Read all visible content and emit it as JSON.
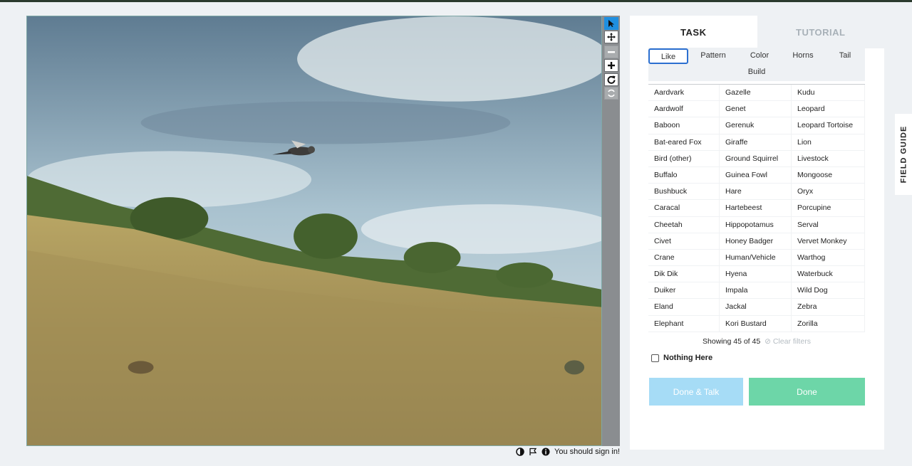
{
  "colors": {
    "accent_blue": "#2b6fd0",
    "talk_button": "#a6dcf6",
    "done_button": "#6dd6a8",
    "toolbar": "#8a8d90"
  },
  "toolbar": {
    "tools": [
      {
        "name": "pointer-tool",
        "icon": "cursor-arrow-icon",
        "state": "active"
      },
      {
        "name": "pan-tool",
        "icon": "move-arrows-icon",
        "state": "normal"
      },
      {
        "name": "zoom-out-tool",
        "icon": "minus-icon",
        "state": "disabled"
      },
      {
        "name": "zoom-in-tool",
        "icon": "plus-icon",
        "state": "normal"
      },
      {
        "name": "rotate-tool",
        "icon": "rotate-icon",
        "state": "normal"
      },
      {
        "name": "reset-tool",
        "icon": "refresh-icon",
        "state": "disabled"
      }
    ]
  },
  "footer": {
    "sign_in_text": "You should sign in!",
    "icons": [
      "contrast-icon",
      "flag-icon",
      "info-icon"
    ]
  },
  "tabs": {
    "task": "TASK",
    "tutorial": "TUTORIAL"
  },
  "filters": {
    "row1": [
      "Like",
      "Pattern",
      "Color",
      "Horns",
      "Tail"
    ],
    "row2": [
      "Build"
    ],
    "selected": "Like"
  },
  "species": {
    "col1": [
      "Aardvark",
      "Aardwolf",
      "Baboon",
      "Bat-eared Fox",
      "Bird (other)",
      "Buffalo",
      "Bushbuck",
      "Caracal",
      "Cheetah",
      "Civet",
      "Crane",
      "Dik Dik",
      "Duiker",
      "Eland",
      "Elephant"
    ],
    "col2": [
      "Gazelle",
      "Genet",
      "Gerenuk",
      "Giraffe",
      "Ground Squirrel",
      "Guinea Fowl",
      "Hare",
      "Hartebeest",
      "Hippopotamus",
      "Honey Badger",
      "Human/Vehicle",
      "Hyena",
      "Impala",
      "Jackal",
      "Kori Bustard"
    ],
    "col3": [
      "Kudu",
      "Leopard",
      "Leopard Tortoise",
      "Lion",
      "Livestock",
      "Mongoose",
      "Oryx",
      "Porcupine",
      "Serval",
      "Vervet Monkey",
      "Warthog",
      "Waterbuck",
      "Wild Dog",
      "Zebra",
      "Zorilla"
    ]
  },
  "showing": {
    "text": "Showing 45 of 45",
    "clear": "Clear filters"
  },
  "nothing_here": "Nothing Here",
  "buttons": {
    "done_talk": "Done & Talk",
    "done": "Done"
  },
  "field_guide": "FIELD GUIDE"
}
